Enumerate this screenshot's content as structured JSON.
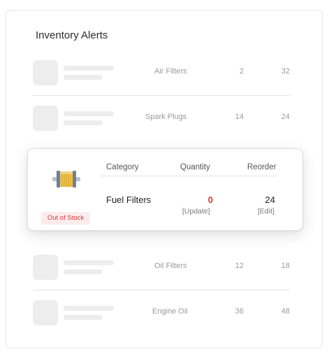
{
  "title": "Inventory Alerts",
  "rows": [
    {
      "category": "Air Filters",
      "quantity": "2",
      "reorder": "32"
    },
    {
      "category": "Spark Plugs",
      "quantity": "14",
      "reorder": "24"
    },
    {
      "category": "Oil Filters",
      "quantity": "12",
      "reorder": "18"
    },
    {
      "category": "Engine Oil",
      "quantity": "36",
      "reorder": "48"
    }
  ],
  "detail": {
    "headers": {
      "category": "Category",
      "quantity": "Quantity",
      "reorder": "Reorder"
    },
    "category": "Fuel Filters",
    "quantity": "0",
    "reorder": "24",
    "update_label": "[Update]",
    "edit_label": "[Edit]",
    "status": "Out of Stock",
    "icon": "fuel-filter-icon"
  },
  "colors": {
    "alert": "#d23a3a",
    "badge_bg": "#fdecec",
    "skeleton": "#ededed"
  }
}
